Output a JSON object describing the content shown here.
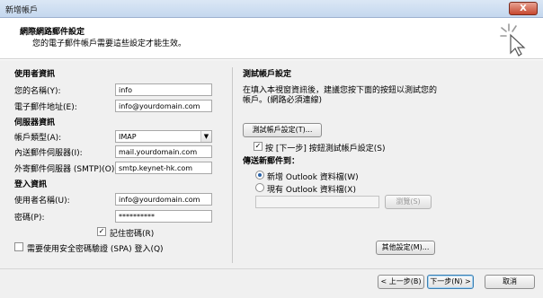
{
  "window": {
    "title": "新增帳戶",
    "close_glyph": "X"
  },
  "header": {
    "title": "網際網路郵件設定",
    "subtitle": "您的電子郵件帳戶需要這些設定才能生效。",
    "icon": "cursor-click-icon"
  },
  "user_info": {
    "section_title": "使用者資訊",
    "name_label": "您的名稱(Y):",
    "name_value": "info",
    "email_label": "電子郵件地址(E):",
    "email_value": "info@yourdomain.com"
  },
  "server_info": {
    "section_title": "伺服器資訊",
    "account_type_label": "帳戶類型(A):",
    "account_type_value": "IMAP",
    "incoming_label": "內送郵件伺服器(I):",
    "incoming_value": "mail.yourdomain.com",
    "outgoing_label": "外寄郵件伺服器 (SMTP)(O):",
    "outgoing_value": "smtp.keynet-hk.com"
  },
  "logon_info": {
    "section_title": "登入資訊",
    "username_label": "使用者名稱(U):",
    "username_value": "info@yourdomain.com",
    "password_label": "密碼(P):",
    "password_value": "**********",
    "remember_label": "記住密碼(R)",
    "remember_checked": true,
    "spa_label": "需要使用安全密碼驗證 (SPA) 登入(Q)",
    "spa_checked": false
  },
  "test_settings": {
    "section_title": "測試帳戶設定",
    "description_line1": "在填入本視窗資訊後，建議您按下面的按鈕以測試您的",
    "description_line2": "帳戶。(網路必須連線)",
    "test_button": "測試帳戶設定(T)...",
    "auto_test_label": "按 [下一步] 按鈕測試帳戶設定(S)",
    "auto_test_checked": true
  },
  "deliver": {
    "section_title": "傳送新郵件到：",
    "option_new": "新增 Outlook 資料檔(W)",
    "option_existing": "現有 Outlook 資料檔(X)",
    "selected": "new",
    "path_value": "",
    "browse_button": "瀏覽(S)"
  },
  "more_settings_button": "其他設定(M)...",
  "footer": {
    "back_button": "< 上一步(B)",
    "next_button": "下一步(N) >",
    "cancel_button": "取消"
  },
  "colors": {
    "title_bar": "#c4d7ee",
    "panel": "#f0f0f0",
    "close_button": "#c6472f"
  }
}
